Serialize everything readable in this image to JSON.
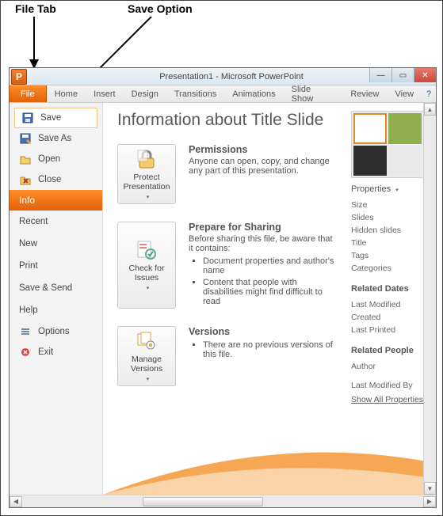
{
  "annotations": {
    "file_tab": "File Tab",
    "save_option": "Save Option"
  },
  "titlebar": {
    "app_icon_letter": "P",
    "title": "Presentation1 - Microsoft PowerPoint",
    "min": "—",
    "max": "▭",
    "close": "✕"
  },
  "ribbon": {
    "file": "File",
    "tabs": [
      "Home",
      "Insert",
      "Design",
      "Transitions",
      "Animations",
      "Slide Show",
      "Review",
      "View"
    ],
    "help": "?"
  },
  "sidebar": {
    "save": "Save",
    "save_as": "Save As",
    "open": "Open",
    "close": "Close",
    "info": "Info",
    "recent": "Recent",
    "new": "New",
    "print": "Print",
    "save_send": "Save & Send",
    "help": "Help",
    "options": "Options",
    "exit": "Exit"
  },
  "main": {
    "title": "Information about Title Slide",
    "protect": {
      "btn": "Protect Presentation",
      "heading": "Permissions",
      "desc": "Anyone can open, copy, and change any part of this presentation."
    },
    "prepare": {
      "btn": "Check for Issues",
      "heading": "Prepare for Sharing",
      "desc": "Before sharing this file, be aware that it contains:",
      "bullets": [
        "Document properties and author's name",
        "Content that people with disabilities might find difficult to read"
      ]
    },
    "versions": {
      "btn": "Manage Versions",
      "heading": "Versions",
      "bullets": [
        "There are no previous versions of this file."
      ]
    }
  },
  "right": {
    "properties": "Properties",
    "list1": [
      "Size",
      "Slides",
      "Hidden slides",
      "Title",
      "Tags",
      "Categories"
    ],
    "dates_h": "Related Dates",
    "dates": [
      "Last Modified",
      "Created",
      "Last Printed"
    ],
    "people_h": "Related People",
    "people": [
      "Author"
    ],
    "lastmod": "Last Modified By",
    "showall": "Show All Properties"
  }
}
